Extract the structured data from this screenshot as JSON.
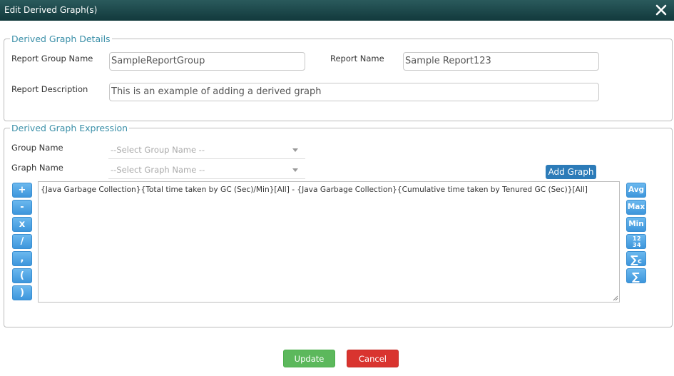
{
  "dialog": {
    "title": "Edit Derived Graph(s)"
  },
  "details": {
    "legend": "Derived Graph Details",
    "report_group_label": "Report Group Name",
    "report_group_value": "SampleReportGroup",
    "report_name_label": "Report Name",
    "report_name_value": "Sample Report123",
    "description_label": "Report Description",
    "description_value": "This is an example of adding a derived graph"
  },
  "expression": {
    "legend": "Derived Graph Expression",
    "group_name_label": "Group Name",
    "group_name_placeholder": "--Select Group Name --",
    "graph_name_label": "Graph Name",
    "graph_name_placeholder": "--Select Graph Name --",
    "add_graph_label": "Add Graph",
    "text": "{Java Garbage Collection}{Total time taken by GC (Sec)/Min}[All] - {Java Garbage Collection}{Cumulative time taken by Tenured GC (Sec)}[All]",
    "operators": [
      "+",
      "-",
      "x",
      "/",
      ",",
      "(",
      ")"
    ],
    "functions": [
      "Avg",
      "Max",
      "Min"
    ],
    "function_icons": [
      "numbers-icon",
      "sum-count-icon",
      "sum-icon"
    ]
  },
  "footer": {
    "update_label": "Update",
    "cancel_label": "Cancel"
  },
  "colors": {
    "title_bar": "#1e4a4d",
    "legend": "#3a8fa8",
    "op_button": "#4aa3e6",
    "add_graph": "#2c7bb8",
    "update": "#5cb85c",
    "cancel": "#d9342f"
  }
}
